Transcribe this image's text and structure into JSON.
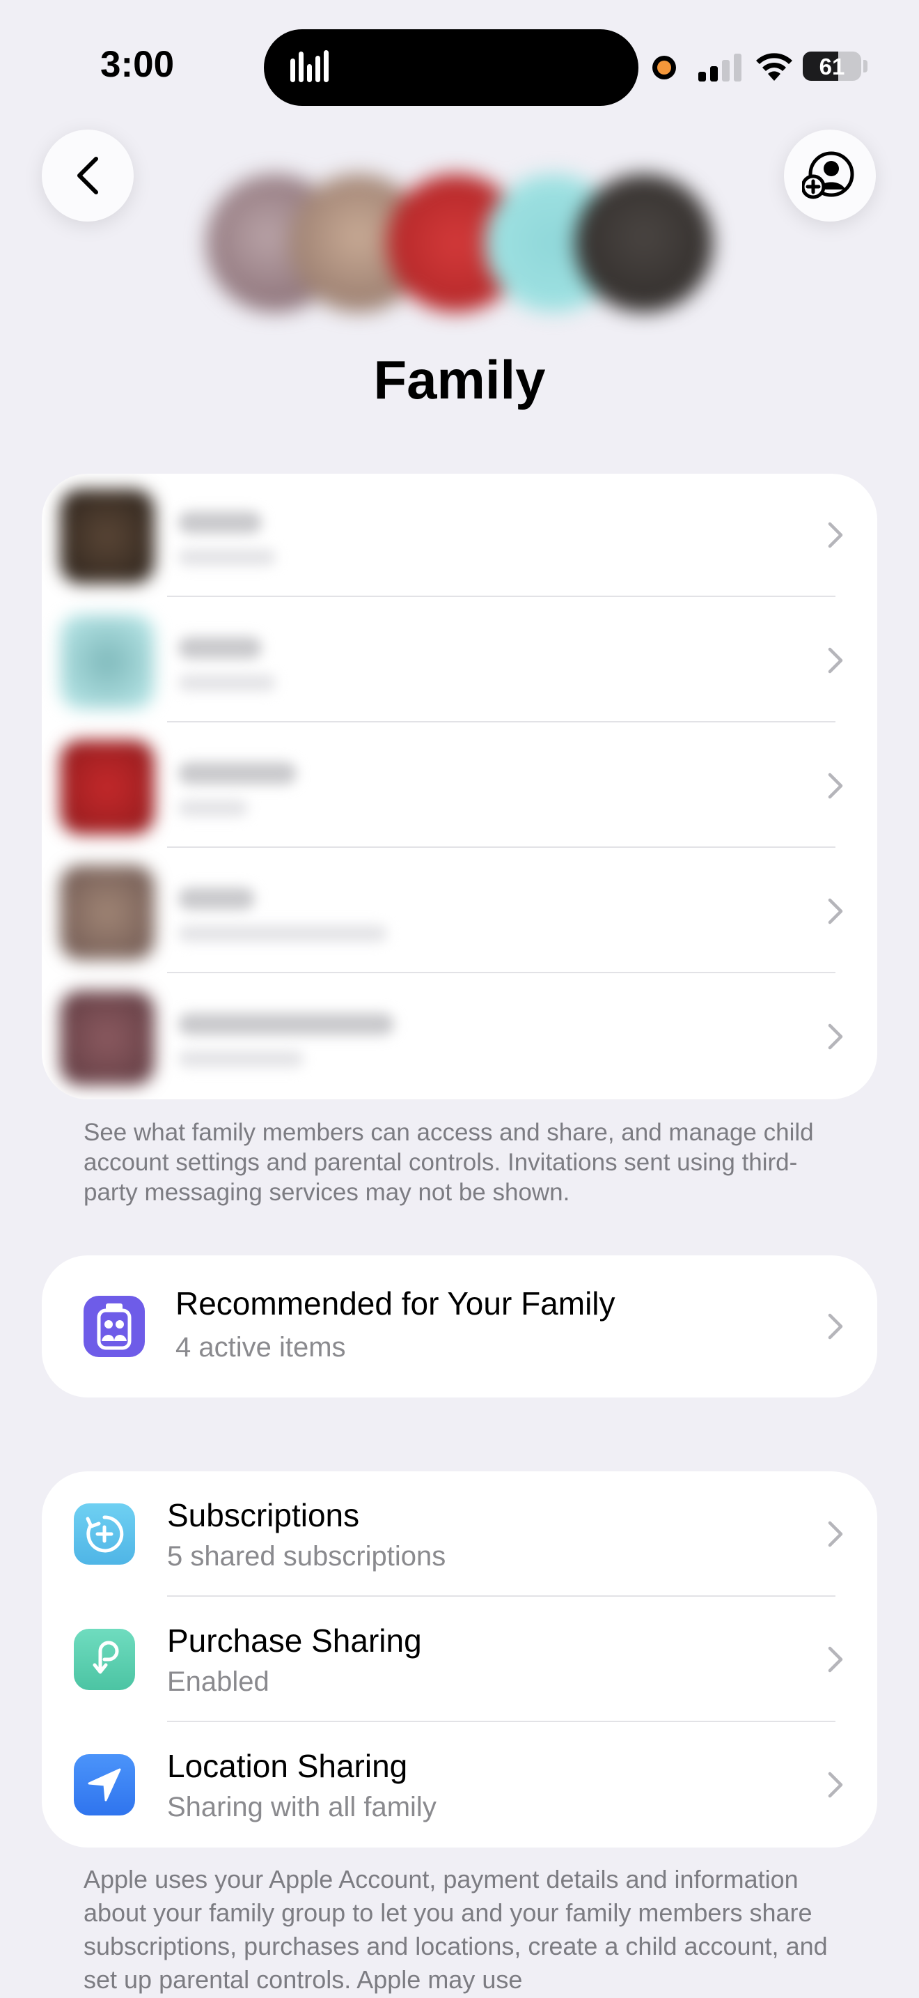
{
  "status_bar": {
    "time": "3:00",
    "battery": "61",
    "battery_level": 0.61
  },
  "nav": {
    "back_icon": "chevron-left-icon",
    "add_member_icon": "person-add-icon"
  },
  "page": {
    "title": "Family"
  },
  "members": {
    "count": 5
  },
  "members_footer": "See what family members can access and share, and manage child account settings and parental controls. Invitations sent using third-party messaging services may not be shown.",
  "recommended": {
    "title": "Recommended for Your Family",
    "subtitle": "4 active items",
    "icon": "family-checklist-icon",
    "color": "#6e5ce8"
  },
  "settings_items": [
    {
      "title": "Subscriptions",
      "subtitle": "5 shared subscriptions",
      "icon": "subscriptions-icon",
      "color": "#5ec4ec"
    },
    {
      "title": "Purchase Sharing",
      "subtitle": "Enabled",
      "icon": "purchase-sharing-icon",
      "color": "#5fd3b3"
    },
    {
      "title": "Location Sharing",
      "subtitle": "Sharing with all family",
      "icon": "location-arrow-icon",
      "color": "#3a82f7"
    }
  ],
  "bottom_footer": "Apple uses your Apple Account, payment details and information about your family group to let you and your family members share subscriptions, purchases and locations, create a child account, and set up parental controls. Apple may use"
}
